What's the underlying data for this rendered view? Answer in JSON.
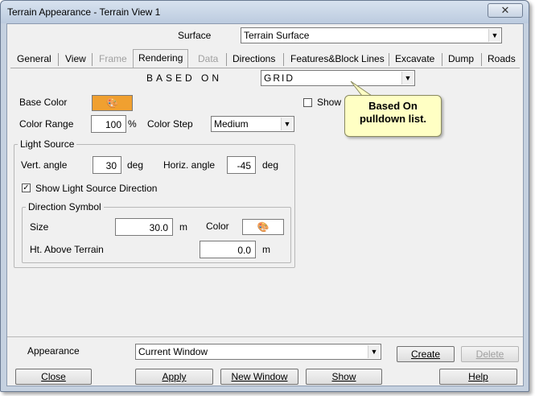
{
  "window": {
    "title": "Terrain Appearance - Terrain View 1",
    "close_glyph": "✕"
  },
  "surface": {
    "label": "Surface",
    "value": "Terrain Surface"
  },
  "tabs": [
    {
      "label": "General",
      "state": "normal"
    },
    {
      "label": "View",
      "state": "normal"
    },
    {
      "label": "Frame",
      "state": "disabled"
    },
    {
      "label": "Rendering",
      "state": "active"
    },
    {
      "label": "Data",
      "state": "disabled"
    },
    {
      "label": "Directions",
      "state": "normal"
    },
    {
      "label": "Features&Block Lines",
      "state": "normal"
    },
    {
      "label": "Excavate",
      "state": "normal"
    },
    {
      "label": "Dump",
      "state": "normal"
    },
    {
      "label": "Roads",
      "state": "normal"
    }
  ],
  "rendering": {
    "based_on_label": "BASED ON",
    "based_on_value": "GRID",
    "base_color_label": "Base Color",
    "base_color": "#f0a030",
    "show_label": "Show F",
    "color_range_label": "Color Range",
    "color_range_value": "100",
    "color_range_unit": "%",
    "color_step_label": "Color Step",
    "color_step_value": "Medium",
    "light_source": {
      "title": "Light Source",
      "vert_label": "Vert. angle",
      "vert_value": "30",
      "vert_unit": "deg",
      "horiz_label": "Horiz. angle",
      "horiz_value": "-45",
      "horiz_unit": "deg",
      "show_direction_label": "Show Light Source Direction",
      "show_direction_checked": true,
      "direction_symbol": {
        "title": "Direction Symbol",
        "size_label": "Size",
        "size_value": "30.0",
        "size_unit": "m",
        "color_label": "Color",
        "color": "#ffffff",
        "ht_label": "Ht. Above Terrain",
        "ht_value": "0.0",
        "ht_unit": "m"
      }
    }
  },
  "tooltip": {
    "line1": "Based On",
    "line2": "pulldown list."
  },
  "appearance": {
    "label": "Appearance",
    "value": "Current Window"
  },
  "buttons": {
    "create": "Create",
    "delete": "Delete",
    "close": "Close",
    "apply": "Apply",
    "new_window": "New Window",
    "show": "Show",
    "help": "Help"
  },
  "icons": {
    "dropdown": "▼",
    "check": "✓",
    "color_picker": "🎨"
  }
}
